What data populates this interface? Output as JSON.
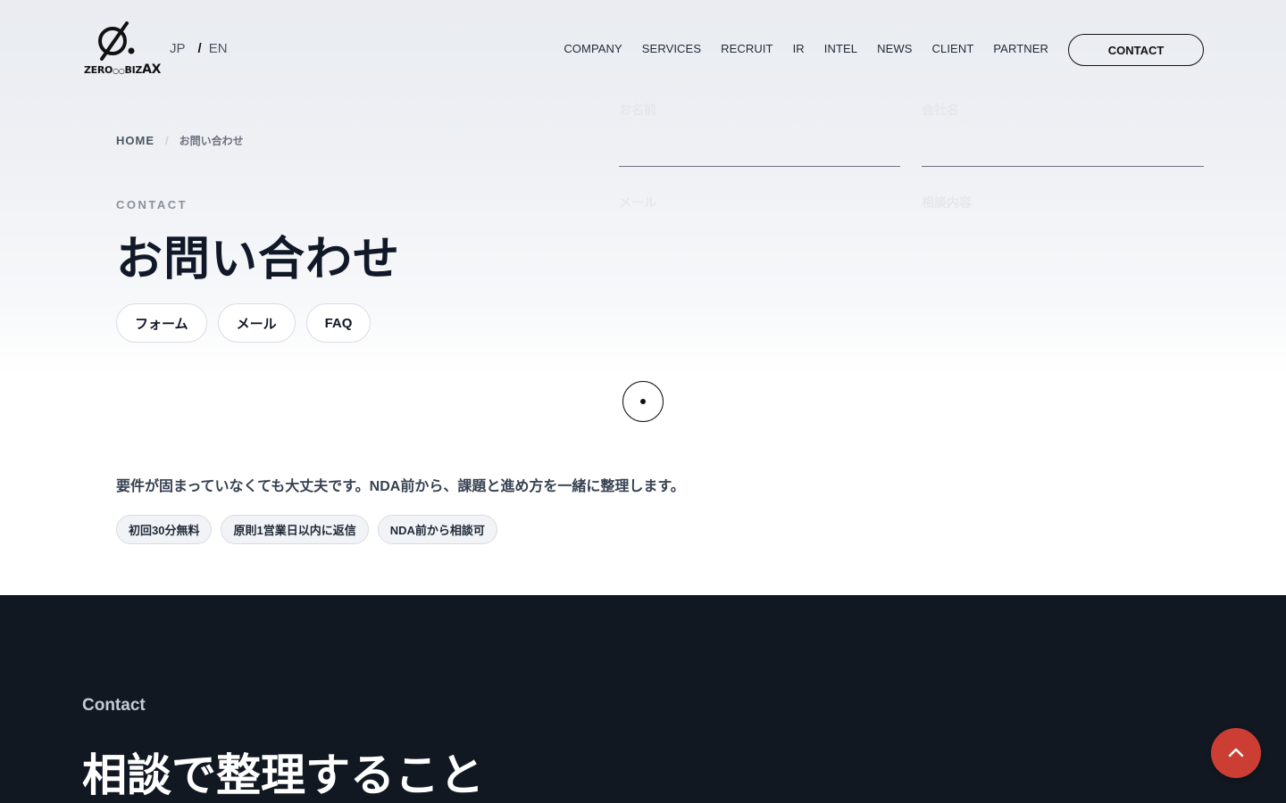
{
  "header": {
    "logo": {
      "mark": "Ø.",
      "text_main": "ZERO",
      "text_mid": "BIZ",
      "text_ax": "AX"
    },
    "lang": {
      "jp": "JP",
      "separator": "/",
      "en": "EN"
    },
    "nav": [
      "COMPANY",
      "SERVICES",
      "RECRUIT",
      "IR",
      "INTEL",
      "NEWS",
      "CLIENT",
      "PARTNER"
    ],
    "contact_label": "CONTACT"
  },
  "breadcrumb": {
    "home": "HOME",
    "separator": "/",
    "current": "お問い合わせ"
  },
  "hero": {
    "eyebrow": "CONTACT",
    "title": "お問い合わせ",
    "tabs": [
      "フォーム",
      "メール",
      "FAQ"
    ]
  },
  "intro": {
    "lead": "要件が固まっていなくても大丈夫です。NDA前から、課題と進め方を一緒に整理します。",
    "chips": [
      "初回30分無料",
      "原則1営業日以内に返信",
      "NDA前から相談可"
    ]
  },
  "contact_section": {
    "eyebrow": "Contact",
    "heading": "相談で整理すること",
    "fields": {
      "name": "お名前",
      "company": "会社名",
      "email": "メール",
      "inquiry": "相談内容"
    }
  },
  "colors": {
    "dark_bg": "#111821",
    "accent": "#cc3d33"
  },
  "icons": {
    "scroll": "scroll-indicator-icon",
    "back_to_top": "chevron-up-icon"
  }
}
